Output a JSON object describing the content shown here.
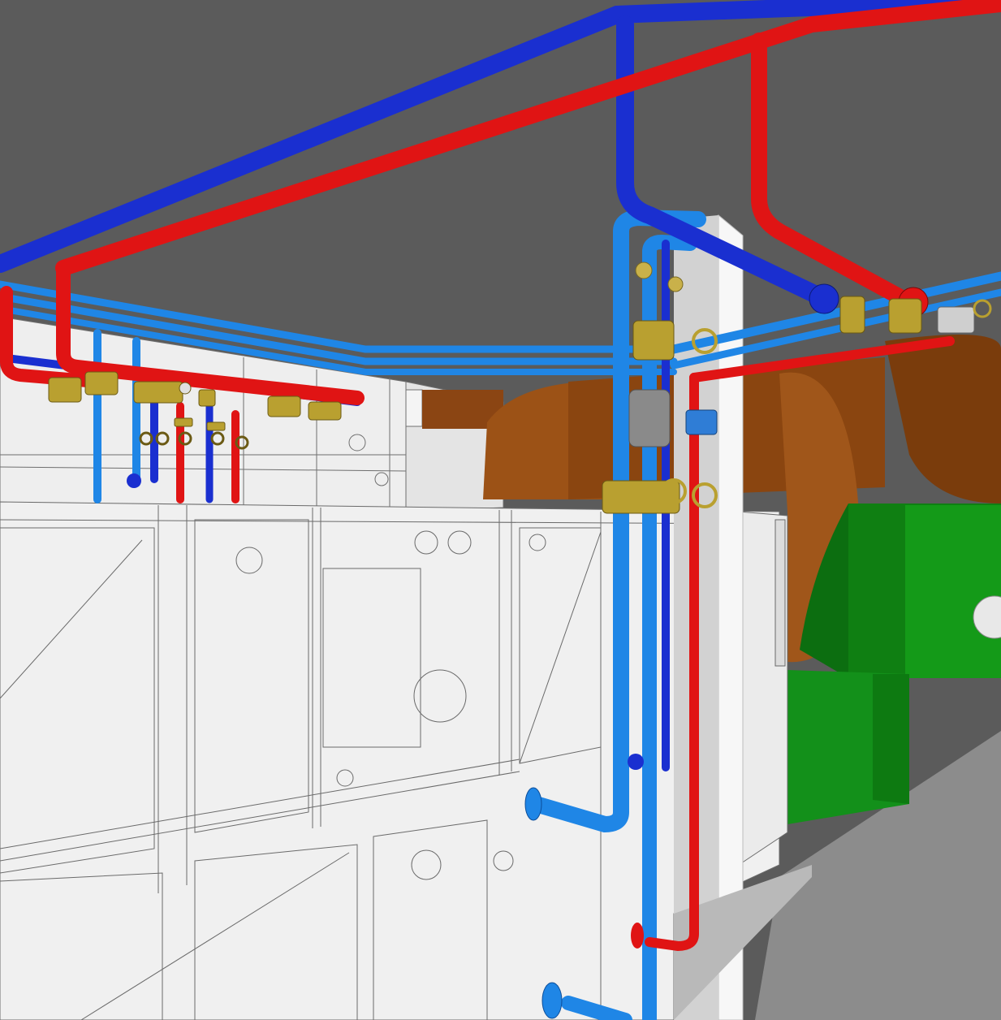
{
  "scene": {
    "colors": {
      "ceiling": "#5b5b5b",
      "floor": "#8a8a8a",
      "ahu_face": "#efefef",
      "ahu_line": "#6f6f6f",
      "column": "#ffffff",
      "return_pipe": "#1a2fd0",
      "supply_pipe": "#e01414",
      "chilled_pipe": "#1f86e6",
      "duct_brown": "#8f4a12",
      "duct_green": "#0f8a14",
      "valve_brass": "#b9a030",
      "actuator": "#2f7dd6"
    },
    "icons": [
      "gauge-icon",
      "handwheel-valve-icon",
      "actuator-icon",
      "flange-icon"
    ]
  }
}
